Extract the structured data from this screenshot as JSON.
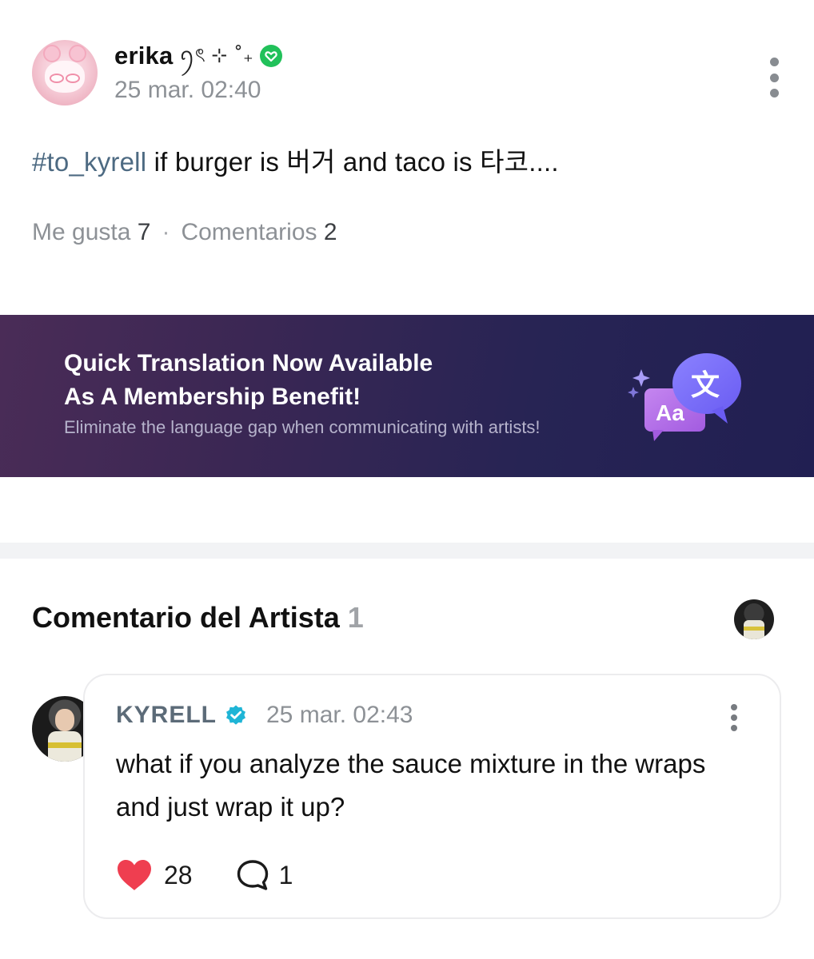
{
  "post": {
    "author": "erika",
    "author_decoration": "ꪆৎ ⊹ ˚₊",
    "time": "25 mar. 02:40",
    "hashtag": "#to_kyrell",
    "text": " if burger is 버거 and taco is 타코....",
    "likes_label": "Me gusta",
    "likes_count": "7",
    "comments_label": "Comentarios",
    "comments_count": "2",
    "separator": "·"
  },
  "banner": {
    "title_line1": "Quick Translation Now Available",
    "title_line2": "As A Membership Benefit!",
    "subtitle": "Eliminate the language gap when communicating with artists!",
    "icon_glyph": "文",
    "icon_text": "Aa"
  },
  "artist_section": {
    "title": "Comentario del Artista",
    "count": "1"
  },
  "comment": {
    "author": "KYRELL",
    "time": "25 mar. 02:43",
    "text": "what if you analyze the sauce mixture in the wraps and just wrap it up?",
    "likes": "28",
    "replies": "1"
  },
  "colors": {
    "hashtag": "#4d6a82",
    "verified_green": "#21c15a",
    "verified_blue": "#1fb5d6",
    "heart": "#ef3e50",
    "banner_start": "#4a2c57",
    "banner_end": "#211f52"
  },
  "icons": [
    "more-vertical-icon",
    "verified-badge-icon",
    "heart-icon",
    "comment-bubble-icon",
    "translate-icon",
    "sparkle-icon"
  ]
}
